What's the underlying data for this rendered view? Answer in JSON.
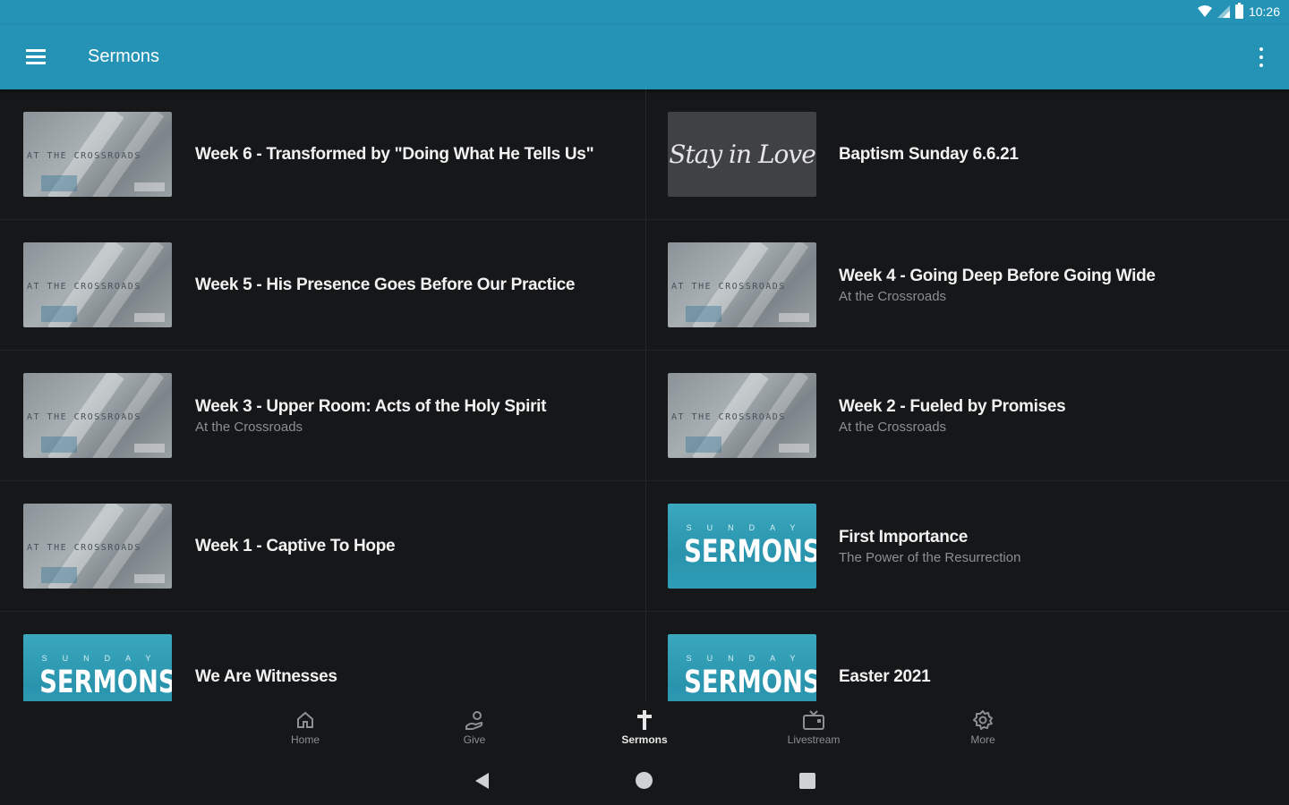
{
  "status_bar": {
    "time": "10:26",
    "icons": [
      "wifi-icon",
      "signal-icon",
      "battery-icon"
    ]
  },
  "app_bar": {
    "title": "Sermons",
    "menu_icon": "menu-icon",
    "overflow_icon": "overflow-icon"
  },
  "sermons": [
    {
      "title": "Week 6 - Transformed by \"Doing What He Tells Us\"",
      "subtitle": "",
      "thumb": "crossroads"
    },
    {
      "title": "Baptism Sunday 6.6.21",
      "subtitle": "",
      "thumb": "stay-in-love"
    },
    {
      "title": "Week 5 - His Presence Goes Before Our Practice",
      "subtitle": "",
      "thumb": "crossroads"
    },
    {
      "title": "Week 4 - Going Deep Before Going Wide",
      "subtitle": "At the Crossroads",
      "thumb": "crossroads"
    },
    {
      "title": "Week 3 - Upper Room: Acts of the Holy Spirit",
      "subtitle": "At the Crossroads",
      "thumb": "crossroads"
    },
    {
      "title": "Week 2 - Fueled by Promises",
      "subtitle": "At the Crossroads",
      "thumb": "crossroads"
    },
    {
      "title": "Week 1 - Captive To Hope",
      "subtitle": "",
      "thumb": "crossroads"
    },
    {
      "title": "First Importance",
      "subtitle": "The Power of the Resurrection",
      "thumb": "sunday-sermons"
    },
    {
      "title": "We Are Witnesses",
      "subtitle": "",
      "thumb": "sunday-sermons"
    },
    {
      "title": "Easter 2021",
      "subtitle": "",
      "thumb": "sunday-sermons"
    }
  ],
  "thumbnails": {
    "crossroads_text": "AT THE CROSSROADS",
    "stay_text": "Stay in Love",
    "sunday_text": "SUNDAY",
    "sermons_text": "SERMONS"
  },
  "bottom_nav": [
    {
      "label": "Home",
      "icon": "home-icon",
      "active": false
    },
    {
      "label": "Give",
      "icon": "give-icon",
      "active": false
    },
    {
      "label": "Sermons",
      "icon": "cross-icon",
      "active": true
    },
    {
      "label": "Livestream",
      "icon": "tv-icon",
      "active": false
    },
    {
      "label": "More",
      "icon": "gear-icon",
      "active": false
    }
  ],
  "colors": {
    "accent": "#2493b5",
    "background": "#151719",
    "text": "#f2f2f2",
    "muted": "#8c8f93"
  }
}
